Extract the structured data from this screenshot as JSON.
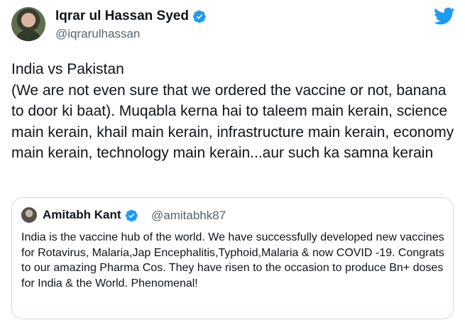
{
  "author": {
    "name": "Iqrar ul Hassan Syed",
    "handle": "@iqrarulhassan",
    "verified_icon": "verified-badge-icon",
    "avatar_icon": "avatar"
  },
  "brand_icon": "twitter-bird-icon",
  "tweet": {
    "text": "India vs Pakistan\n(We are not even sure that we ordered the vaccine or not, banana to door ki baat). Muqabla kerna hai to taleem main kerain, science main kerain, khail main kerain, infrastructure main kerain, economy main kerain, technology main kerain...aur such ka samna kerain"
  },
  "quoted_tweet": {
    "name": "Amitabh Kant",
    "handle": "@amitabhk87",
    "text": "India is the vaccine hub of the world. We have successfully developed new vaccines for Rotavirus, Malaria,Jap Encephalitis,Typhoid,Malaria & now COVID -19. Congrats to our amazing Pharma Cos. They have risen to the occasion to produce Bn+ doses for India & the World. Phenomenal!"
  },
  "colors": {
    "accent": "#1d9bf0",
    "text": "#0f1419",
    "secondary": "#536471",
    "border": "#cfd9de"
  }
}
